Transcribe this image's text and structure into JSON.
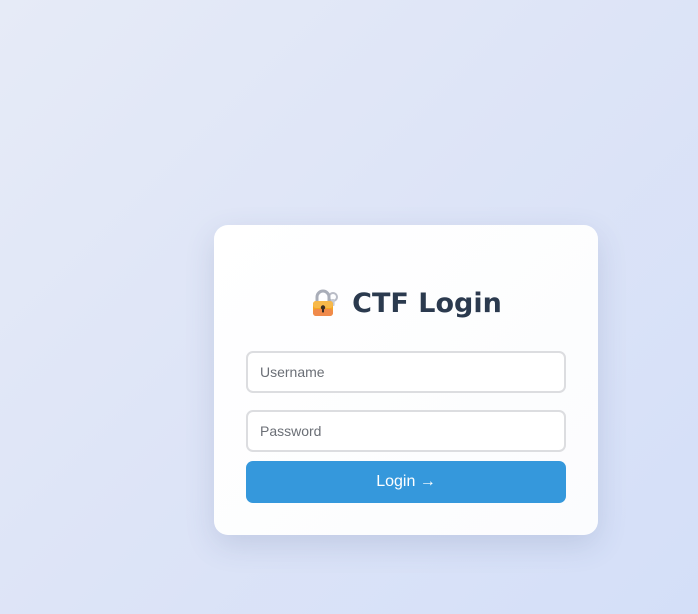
{
  "login": {
    "title": "CTF Login",
    "title_icon": "lock-icon",
    "username_placeholder": "Username",
    "username_value": "",
    "password_placeholder": "Password",
    "password_value": "",
    "submit_label": "Login →"
  },
  "colors": {
    "accent": "#3598dc",
    "title": "#2b3a4e",
    "background_start": "#e6ebf7",
    "background_end": "#d4dff8"
  }
}
